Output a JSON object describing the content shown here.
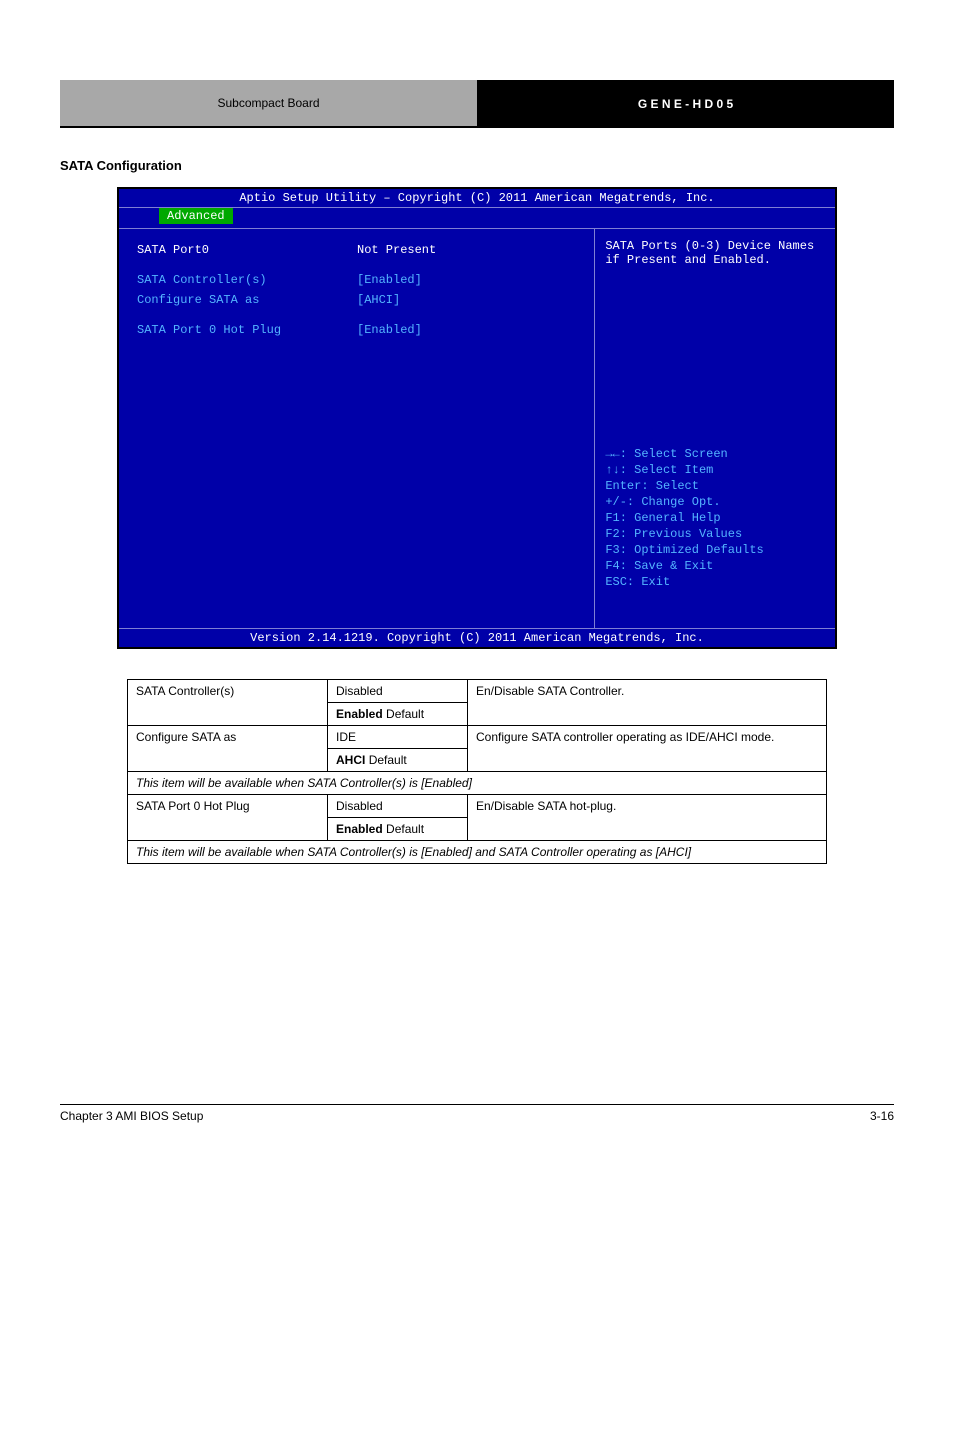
{
  "header": {
    "left": "Subcompact Board",
    "right": "G E N E - H D 0 5"
  },
  "section_heading": "SATA Configuration",
  "bios": {
    "title": "Aptio Setup Utility – Copyright (C) 2011 American Megatrends, Inc.",
    "tab": "Advanced",
    "left": {
      "rows": [
        {
          "label": "SATA Port0",
          "value": "Not Present",
          "selected": true
        },
        {
          "label": "  SATA Controller(s)",
          "value": "[Enabled]",
          "selected": false
        },
        {
          "label": "  Configure SATA as",
          "value": "[AHCI]",
          "selected": false
        },
        {
          "label": "    SATA Port 0 Hot Plug",
          "value": "[Enabled]",
          "selected": false
        }
      ]
    },
    "right": {
      "help": "SATA Ports (0-3) Device Names if Present and Enabled.",
      "hints": [
        "→←: Select Screen",
        "↑↓: Select Item",
        "Enter: Select",
        "+/-: Change Opt.",
        "F1: General Help",
        "F2: Previous Values",
        "F3: Optimized Defaults",
        "F4: Save & Exit",
        "ESC: Exit"
      ]
    },
    "footer": "Version 2.14.1219. Copyright (C) 2011 American Megatrends, Inc."
  },
  "table": {
    "rows": [
      {
        "name": "SATA Controller(s)",
        "options": [
          "Disabled",
          "Enabled"
        ],
        "default_index": 1,
        "desc": "En/Disable SATA Controller.",
        "note_after": ""
      },
      {
        "name": "Configure SATA as",
        "options": [
          "IDE",
          "AHCI"
        ],
        "default_index": 1,
        "desc": "Configure SATA controller operating as IDE/AHCI mode.",
        "note_after": "This item will be available when SATA Controller(s) is [Enabled]"
      },
      {
        "name": "SATA Port 0 Hot Plug",
        "options": [
          "Disabled",
          "Enabled"
        ],
        "default_index": 1,
        "desc": "En/Disable SATA hot-plug.",
        "note_after": "This item will be available when SATA Controller(s) is [Enabled] and SATA Controller operating as [AHCI]"
      }
    ]
  },
  "footer": {
    "left": "Chapter 3 AMI BIOS Setup",
    "right": "3-16"
  }
}
